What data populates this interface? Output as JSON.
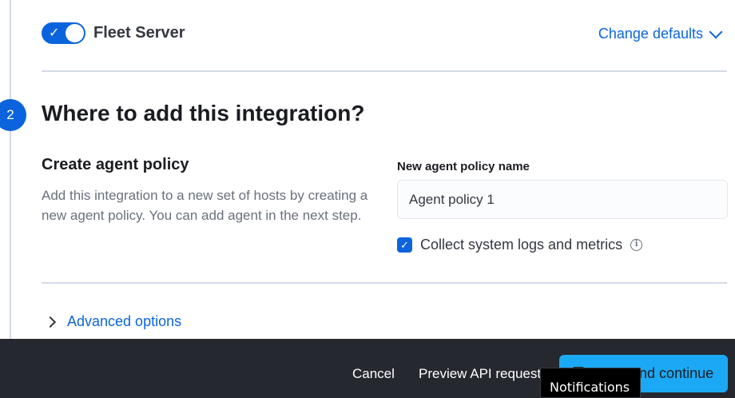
{
  "integration": {
    "toggle_label": "Fleet Server",
    "toggle_on": true,
    "change_defaults_label": "Change defaults"
  },
  "step": {
    "number": "2",
    "title": "Where to add this integration?"
  },
  "create_policy": {
    "title": "Create agent policy",
    "description": "Add this integration to a new set of hosts by creating a new agent policy. You can add agent in the next step."
  },
  "policy_form": {
    "name_label": "New agent policy name",
    "name_value": "Agent policy 1",
    "collect_checked": true,
    "collect_label": "Collect system logs and metrics"
  },
  "advanced": {
    "label": "Advanced options"
  },
  "footer": {
    "cancel_label": "Cancel",
    "preview_label": "Preview API request",
    "save_label": "Save and continue"
  },
  "tooltip": {
    "text": "Notifications"
  },
  "colors": {
    "primary": "#0b64dd",
    "save_button": "#1ba9f5",
    "footer_bg": "#25282f"
  },
  "icons": [
    "check-icon",
    "chevron-down-icon",
    "info-icon",
    "chevron-right-icon",
    "save-icon"
  ]
}
